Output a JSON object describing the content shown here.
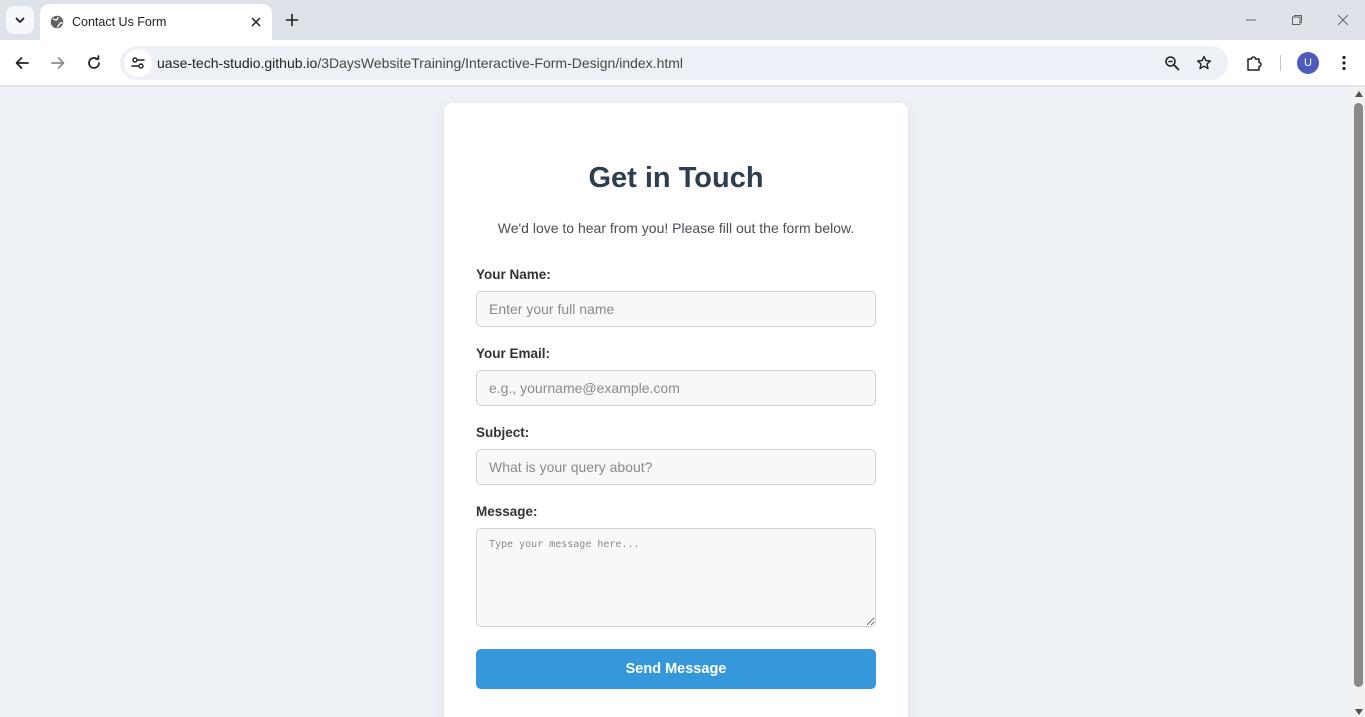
{
  "browser": {
    "tab": {
      "title": "Contact Us Form"
    },
    "address_bar": {
      "host": "uase-tech-studio.github.io",
      "path": "/3DaysWebsiteTraining/Interactive-Form-Design/index.html"
    },
    "profile_initial": "U"
  },
  "form": {
    "title": "Get in Touch",
    "subtitle": "We'd love to hear from you! Please fill out the form below.",
    "name_label": "Your Name:",
    "name_placeholder": "Enter your full name",
    "email_label": "Your Email:",
    "email_placeholder": "e.g., yourname@example.com",
    "subject_label": "Subject:",
    "subject_placeholder": "What is your query about?",
    "message_label": "Message:",
    "message_placeholder": "Type your message here...",
    "submit_label": "Send Message"
  },
  "colors": {
    "primary_button": "#3498db",
    "title_text": "#2c3e50",
    "page_background": "#edf1f5",
    "avatar": "#4f5bb8"
  },
  "icons": {
    "tab_search": "chevron-down-icon",
    "favicon": "globe-icon",
    "tab_close": "close-icon",
    "new_tab": "plus-icon",
    "back": "arrow-left-icon",
    "forward": "arrow-right-icon",
    "reload": "reload-icon",
    "site_info": "tune-icon",
    "zoom": "zoom-icon",
    "bookmark": "star-icon",
    "extensions": "puzzle-icon",
    "menu": "kebab-menu-icon"
  }
}
